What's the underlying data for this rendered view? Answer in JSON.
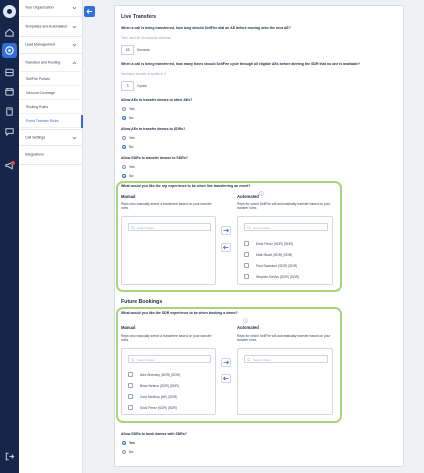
{
  "nav": {
    "items": [
      {
        "label": "Your Organization",
        "chevron": "down"
      },
      {
        "label": "Templates and Automation",
        "chevron": "down"
      },
      {
        "label": "Lead Management",
        "chevron": "down"
      },
      {
        "label": "Transfers and Routing",
        "chevron": "up"
      }
    ],
    "sub_items": [
      {
        "label": "SellFire Portals"
      },
      {
        "label": "Inbound Coverage"
      },
      {
        "label": "Routing Rules"
      },
      {
        "label": "Event Transfer Rules"
      }
    ],
    "bottom_items": [
      {
        "label": "Call Settings",
        "chevron": "down"
      },
      {
        "label": "Integrations"
      }
    ]
  },
  "rail": {
    "icons": [
      "home-icon",
      "contacts-icon",
      "target-icon",
      "inbox-icon",
      "calendar-icon",
      "phone-icon",
      "book-icon",
      "chat-icon",
      "megaphone-icon"
    ],
    "active": "target-icon",
    "logout": "logout-icon"
  },
  "live_transfers": {
    "title": "Live Transfers",
    "q_dial_time": "When a call is being transferred, how long should SellFire dial an AE before moving onto the next AE?",
    "dial_time_hint": "Time must be 30 seconds minimum",
    "dial_time_value": "15",
    "dial_time_unit": "Seconds",
    "q_cycles": "When a call is being transferred, how many times should SellFire cycle through all eligible AEs before alerting the SDR that no one is available?",
    "cycles_hint": "Maximum number of cycles is 3",
    "cycles_value": "3",
    "cycles_unit": "Cycles",
    "q_ae_to_ae": "Allow AEs to transfer demos to other AEs?",
    "q_ae_to_sdr": "Allow AEs to transfer demos to SDRs?",
    "q_sdr_to_sdr": "Allow SDRs to transfer demos to SDRs?",
    "yes": "Yes",
    "no": "No",
    "answers": {
      "ae_to_ae": "No",
      "ae_to_sdr": "No",
      "sdr_to_sdr": "No"
    },
    "q_experience": "What would you like the rep experience to be when live transferring an event?",
    "manual_title": "Manual",
    "manual_desc": "Reps who manually select a transferee based on your transfer rules.",
    "auto_title": "Automated",
    "auto_desc": "Reps for which SellFire will automatically transfer based on your transfer rules.",
    "search_placeholder": "Search Reps",
    "manual_reps": [],
    "auto_reps": [
      "Erick Perez (SDR) (SDR)",
      "Matt Stuart (SDR) (SDR)",
      "Paul Swanson (SDR) (SDR)",
      "Stephen DeVos (SDR) (SDR)"
    ]
  },
  "future_bookings": {
    "title": "Future Bookings",
    "q_experience": "What would you like the SDR experience to be when booking a demo?",
    "manual_title": "Manual",
    "manual_desc": "Reps who manually select a transferee based on your transfer rules.",
    "auto_title": "Automated",
    "auto_desc": "Reps for which SellFire will automatically transfer based on your transfer rules.",
    "search_placeholder": "Search Reps",
    "manual_reps": [
      "Alex Shensky (SDR) (SDR)",
      "Brian Nelson (SDR) (SDR)",
      "Cory McAlroy (AE) (SDR)",
      "Erick Perez (SDR) (SDR)"
    ],
    "auto_reps": [],
    "q_sdr_book": "Allow SDRs to book demos with SDRs?",
    "yes": "Yes",
    "no": "No",
    "answer": "Yes"
  },
  "colors": {
    "accent": "#2f6fd6",
    "highlight": "#a6d57a",
    "rail": "#15264a"
  }
}
